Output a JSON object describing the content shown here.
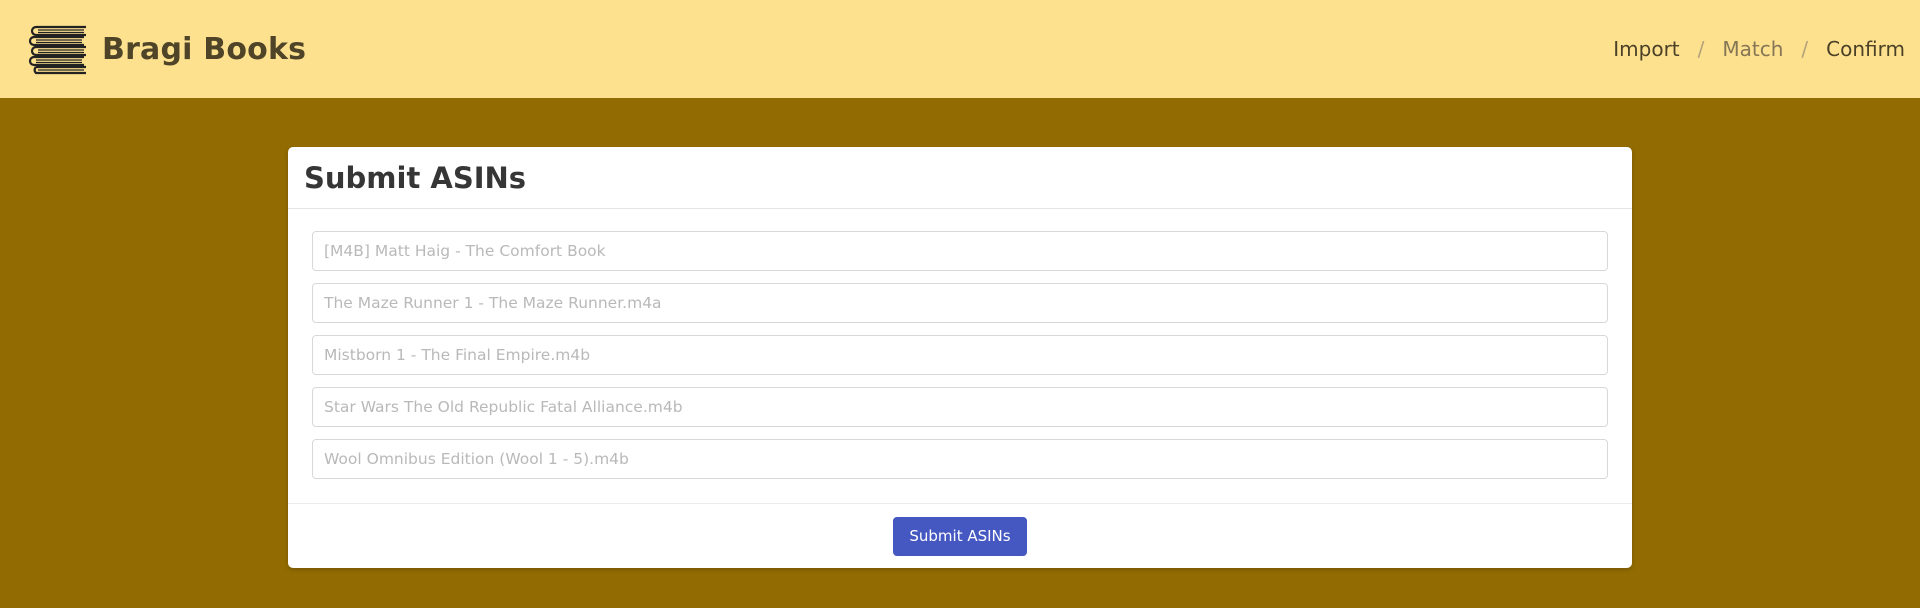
{
  "brand": {
    "name": "Bragi Books",
    "logo_icon": "books-stack-icon"
  },
  "breadcrumb": [
    {
      "label": "Import"
    },
    {
      "label": "Match"
    },
    {
      "label": "Confirm"
    }
  ],
  "breadcrumb_separator": "/",
  "form": {
    "title": "Submit ASINs",
    "fields": [
      {
        "placeholder": "[M4B] Matt Haig - The Comfort Book",
        "value": ""
      },
      {
        "placeholder": "The Maze Runner 1 - The Maze Runner.m4a",
        "value": ""
      },
      {
        "placeholder": "Mistborn 1 - The Final Empire.m4b",
        "value": ""
      },
      {
        "placeholder": "Star Wars The Old Republic Fatal Alliance.m4b",
        "value": ""
      },
      {
        "placeholder": "Wool Omnibus Edition (Wool 1 - 5).m4b",
        "value": ""
      }
    ],
    "submit_label": "Submit ASINs"
  },
  "colors": {
    "page_background": "#936b03",
    "topbar_background": "#fde18f",
    "button": "#4558c1"
  }
}
